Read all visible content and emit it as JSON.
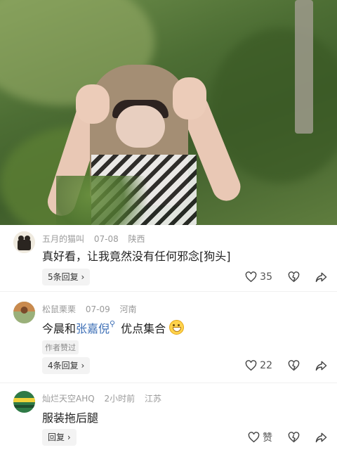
{
  "comments": [
    {
      "username": "五月的猫叫",
      "date": "07-08",
      "location": "陕西",
      "text": "真好看，让我竟然没有任何邪念[狗头]",
      "reply_label": "5条回复",
      "like_count": "35"
    },
    {
      "username": "松鼠栗栗",
      "date": "07-09",
      "location": "河南",
      "text_prefix": "今晨和",
      "mention": "张嘉倪",
      "text_suffix": "优点集合",
      "author_badge": "作者赞过",
      "reply_label": "4条回复",
      "like_count": "22"
    },
    {
      "username": "灿烂天空AHQ",
      "date": "2小时前",
      "location": "江苏",
      "text": "服装拖后腿",
      "reply_label": "回复",
      "like_count": "赞"
    }
  ],
  "icons": {
    "like": "heart-icon",
    "dislike": "dislike-heart-icon",
    "share": "share-arrow-icon",
    "chevron": "chevron-right-icon",
    "mention_search": "search-icon",
    "emoji": "grin-emoji-icon"
  }
}
